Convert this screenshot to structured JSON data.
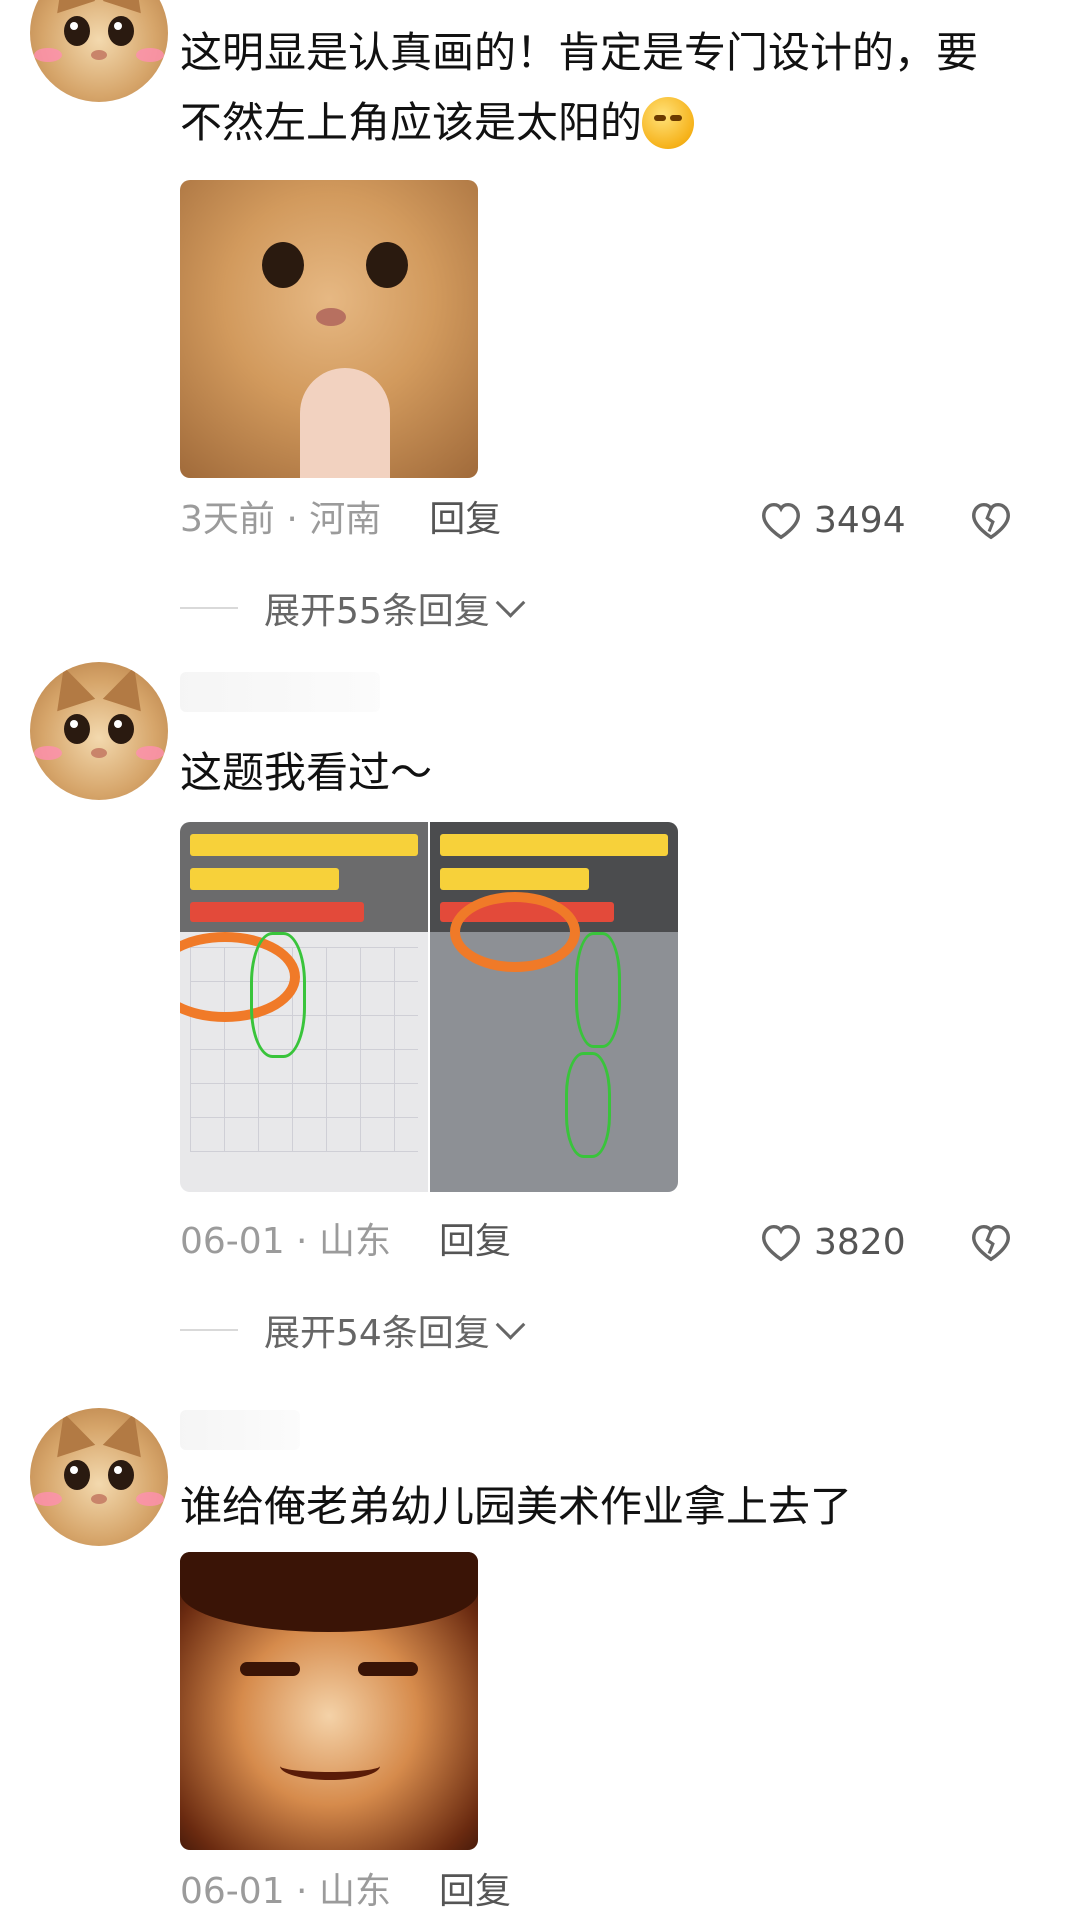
{
  "comments": [
    {
      "text": "这明显是认真画的！肯定是专门设计的，要不然左上角应该是太阳的",
      "emoji": "😑-emoji",
      "time": "3天前",
      "location": "河南",
      "reply_label": "回复",
      "likes": "3494",
      "expand_label": "展开55条回复"
    },
    {
      "text": "这题我看过～",
      "time": "06-01",
      "location": "山东",
      "reply_label": "回复",
      "likes": "3820",
      "expand_label": "展开54条回复"
    },
    {
      "text": "谁给俺老弟幼儿园美术作业拿上去了",
      "time": "06-01",
      "location": "山东",
      "reply_label": "回复"
    }
  ],
  "separator": " · "
}
